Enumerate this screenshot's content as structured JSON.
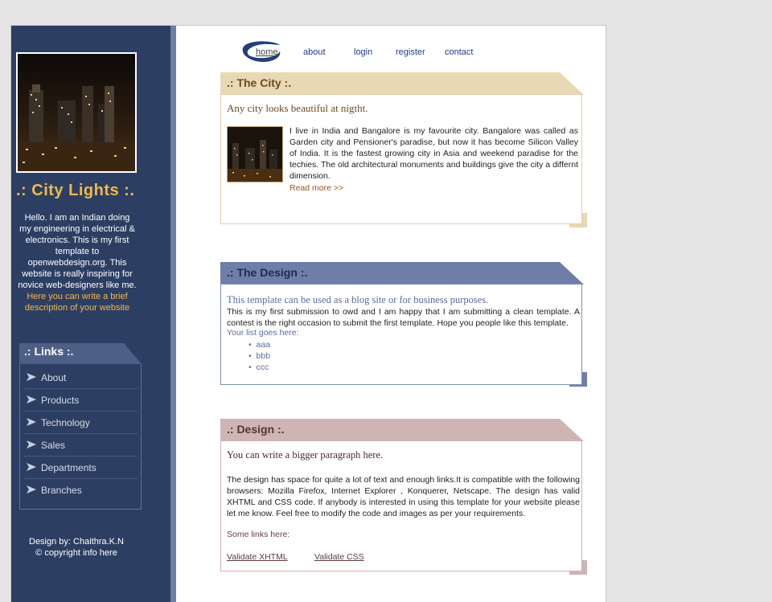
{
  "sidebar": {
    "site_title": ".: City Lights :.",
    "intro": "Hello. I am an Indian doing my engineering in electrical & electronics. This is my first template to openwebdesign.org. This website is really inspiring for novice web-designers like me.",
    "intro_highlight": "Here you can write a brief description of your website",
    "links_title": ".: Links :.",
    "links": [
      {
        "label": "About"
      },
      {
        "label": "Products"
      },
      {
        "label": "Technology"
      },
      {
        "label": "Sales"
      },
      {
        "label": "Departments"
      },
      {
        "label": "Branches"
      }
    ],
    "footer_credit": "Design by: Chaithra.K.N",
    "footer_copyright": "© copyright info here"
  },
  "nav": {
    "items": [
      {
        "label": "home"
      },
      {
        "label": "about"
      },
      {
        "label": "login"
      },
      {
        "label": "register"
      },
      {
        "label": "contact"
      }
    ]
  },
  "city": {
    "title": ".: The City :.",
    "lead": "Any city looks beautiful at nigtht.",
    "body": "I live in India and Bangalore is my favourite city. Bangalore was called as Garden city and Pensioner's paradise, but now it has become Silicon Valley of India. It is the fastest growing city in Asia and weekend paradise for the techies. The old architectural monuments and buildings give the city a differnt dimension.",
    "read_more": "Read more >>"
  },
  "design1": {
    "title": ".: The Design :.",
    "lead": "This template can be used as a blog site or for business purposes.",
    "body": "This is my first submission to owd and I am happy that I am submitting a clean template. A contest is the right occasion to submit the first template. Hope you people like this template.",
    "list_title": "Your list goes here:",
    "list": [
      "aaa",
      "bbb",
      "ccc"
    ]
  },
  "design2": {
    "title": ".: Design :.",
    "lead": "You can write a bigger paragraph here.",
    "body": "The design has space for quite a lot of text and enough links.It is compatible with the following browsers: Mozilla Firefox, Internet Explorer , Konquerer, Netscape. The design has valid XHTML and CSS code. If anybody is interested in using this template for your website please let me know. Feel free to modify the code and images as per your requirements.",
    "links_label": "Some links here:",
    "validate_xhtml": "Validate XHTML",
    "validate_css": "Validate CSS"
  },
  "colors": {
    "sidebar_bg": "#2c3f63",
    "accent_gold": "#f2b84a",
    "city_header": "#e8d9b5",
    "design_header": "#6e7ea8",
    "design2_header": "#cdb5b3"
  }
}
